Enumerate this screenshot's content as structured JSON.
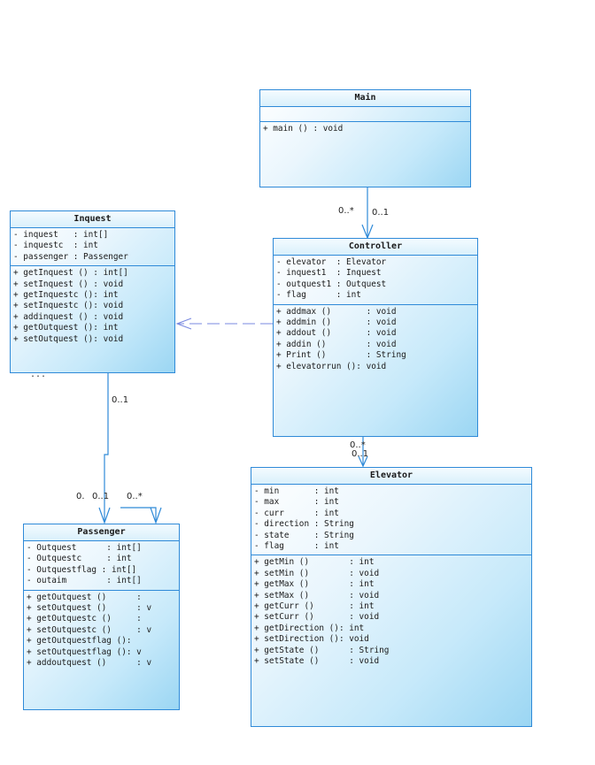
{
  "classes": {
    "main": {
      "name": "Main",
      "attributes": [],
      "operations": [
        "+ main () : void"
      ]
    },
    "controller": {
      "name": "Controller",
      "attributes": [
        "- elevator  : Elevator",
        "- inquest1  : Inquest",
        "- outquest1 : Outquest",
        "- flag      : int"
      ],
      "operations": [
        "+ addmax ()       : void",
        "+ addmin ()       : void",
        "+ addout ()       : void",
        "+ addin ()        : void",
        "+ Print ()        : String",
        "+ elevatorrun (): void"
      ]
    },
    "inquest": {
      "name": "Inquest",
      "attributes": [
        "- inquest   : int[]",
        "- inquestc  : int",
        "- passenger : Passenger"
      ],
      "operations": [
        "+ getInquest () : int[]",
        "+ setInquest () : void",
        "+ getInquestc (): int",
        "+ setInquestc (): void",
        "+ addinquest () : void",
        "+ getOutquest (): int",
        "+ setOutquest (): void"
      ],
      "overflow": "..."
    },
    "passenger": {
      "name": "Passenger",
      "attributes": [
        "- Outquest      : int[]",
        "- Outquestc     : int",
        "- Outquestflag : int[]",
        "- outaim        : int[]"
      ],
      "operations": [
        "+ getOutquest ()      : ",
        "+ setOutquest ()      : v",
        "+ getOutquestc ()     : ",
        "+ setOutquestc ()     : v",
        "+ getOutquestflag (): ",
        "+ setOutquestflag (): v",
        "+ addoutquest ()      : v"
      ]
    },
    "elevator": {
      "name": "Elevator",
      "attributes": [
        "- min       : int",
        "- max       : int",
        "- curr      : int",
        "- direction : String",
        "- state     : String",
        "- flag      : int"
      ],
      "operations": [
        "+ getMin ()        : int",
        "+ setMin ()        : void",
        "+ getMax ()        : int",
        "+ setMax ()        : void",
        "+ getCurr ()       : int",
        "+ setCurr ()       : void",
        "+ getDirection (): int",
        "+ setDirection (): void",
        "+ getState ()      : String",
        "+ setState ()      : void"
      ]
    }
  },
  "multiplicities": {
    "main_controller_source": "0..*",
    "main_controller_target": "0..1",
    "inquest_passenger_source": "0..1",
    "inquest_passenger_target": "0.",
    "passenger_target_2": "0..1",
    "passenger_self": "0..*",
    "controller_elevator_source": "0..*",
    "controller_elevator_target": "0..1"
  },
  "colors": {
    "border": "#2f8ad8",
    "link": "#2f8ad8",
    "dependency": "#7a8ae0"
  }
}
